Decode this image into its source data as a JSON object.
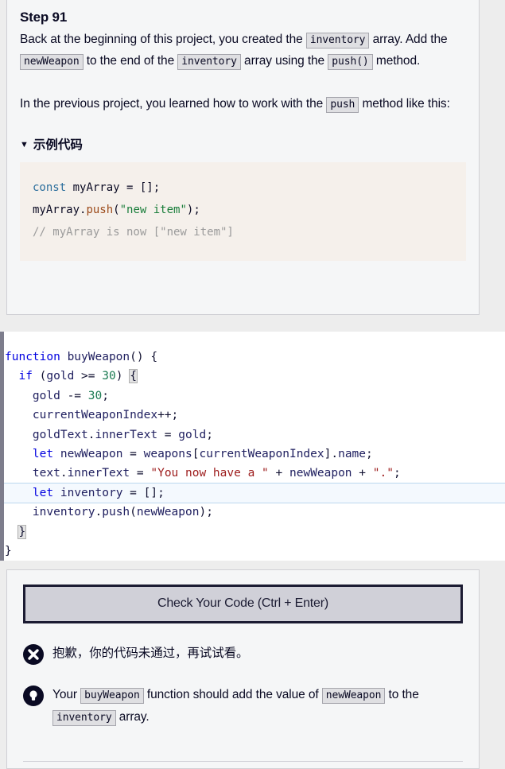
{
  "description": {
    "title": "Step 91",
    "paragraph1": [
      {
        "t": "text",
        "v": "Back at the beginning of this project, you created the "
      },
      {
        "t": "code",
        "v": "inventory"
      },
      {
        "t": "text",
        "v": " array. Add the "
      },
      {
        "t": "code",
        "v": "newWeapon"
      },
      {
        "t": "text",
        "v": " to the end of the "
      },
      {
        "t": "code",
        "v": "inventory"
      },
      {
        "t": "text",
        "v": " array using the "
      },
      {
        "t": "code",
        "v": "push()"
      },
      {
        "t": "text",
        "v": " method."
      }
    ],
    "paragraph2": [
      {
        "t": "text",
        "v": "In the previous project, you learned how to work with the "
      },
      {
        "t": "code",
        "v": "push"
      },
      {
        "t": "text",
        "v": " method like this:"
      }
    ],
    "example": {
      "summary_label": "示例代码",
      "disclosure_glyph": "▼",
      "code_lines": [
        [
          {
            "c": "k-const",
            "v": "const"
          },
          {
            "c": "k-plain",
            "v": " myArray "
          },
          {
            "c": "k-punc",
            "v": "= [];"
          }
        ],
        [
          {
            "c": "k-plain",
            "v": "myArray."
          },
          {
            "c": "k-fn",
            "v": "push"
          },
          {
            "c": "k-punc",
            "v": "("
          },
          {
            "c": "k-str",
            "v": "\"new item\""
          },
          {
            "c": "k-punc",
            "v": ");"
          }
        ],
        [
          {
            "c": "k-cmt",
            "v": "// myArray is now [\"new item\"]"
          }
        ]
      ]
    }
  },
  "editor": {
    "lines": [
      {
        "active": false,
        "tokens": [
          {
            "c": "t-kw",
            "v": "function"
          },
          {
            "c": "t-id",
            "v": " buyWeapon"
          },
          {
            "c": "t-op",
            "v": "() {"
          }
        ]
      },
      {
        "active": false,
        "tokens": [
          {
            "c": "t-op",
            "v": "  "
          },
          {
            "c": "t-kw",
            "v": "if"
          },
          {
            "c": "t-op",
            "v": " ("
          },
          {
            "c": "t-id",
            "v": "gold"
          },
          {
            "c": "t-op",
            "v": " >= "
          },
          {
            "c": "t-num",
            "v": "30"
          },
          {
            "c": "t-op",
            "v": ") "
          },
          {
            "c": "t-op brace-match",
            "v": "{"
          }
        ]
      },
      {
        "active": false,
        "tokens": [
          {
            "c": "t-op",
            "v": "    "
          },
          {
            "c": "t-id",
            "v": "gold"
          },
          {
            "c": "t-op",
            "v": " -= "
          },
          {
            "c": "t-num",
            "v": "30"
          },
          {
            "c": "t-op",
            "v": ";"
          }
        ]
      },
      {
        "active": false,
        "tokens": [
          {
            "c": "t-op",
            "v": "    "
          },
          {
            "c": "t-id",
            "v": "currentWeaponIndex"
          },
          {
            "c": "t-op",
            "v": "++;"
          }
        ]
      },
      {
        "active": false,
        "tokens": [
          {
            "c": "t-op",
            "v": "    "
          },
          {
            "c": "t-id",
            "v": "goldText"
          },
          {
            "c": "t-op",
            "v": "."
          },
          {
            "c": "t-id",
            "v": "innerText"
          },
          {
            "c": "t-op",
            "v": " = "
          },
          {
            "c": "t-id",
            "v": "gold"
          },
          {
            "c": "t-op",
            "v": ";"
          }
        ]
      },
      {
        "active": false,
        "tokens": [
          {
            "c": "t-op",
            "v": "    "
          },
          {
            "c": "t-kw",
            "v": "let"
          },
          {
            "c": "t-id",
            "v": " newWeapon"
          },
          {
            "c": "t-op",
            "v": " = "
          },
          {
            "c": "t-id",
            "v": "weapons"
          },
          {
            "c": "t-op",
            "v": "["
          },
          {
            "c": "t-id",
            "v": "currentWeaponIndex"
          },
          {
            "c": "t-op",
            "v": "]."
          },
          {
            "c": "t-id",
            "v": "name"
          },
          {
            "c": "t-op",
            "v": ";"
          }
        ]
      },
      {
        "active": false,
        "tokens": [
          {
            "c": "t-op",
            "v": "    "
          },
          {
            "c": "t-id",
            "v": "text"
          },
          {
            "c": "t-op",
            "v": "."
          },
          {
            "c": "t-id",
            "v": "innerText"
          },
          {
            "c": "t-op",
            "v": " = "
          },
          {
            "c": "t-str",
            "v": "\"You now have a \""
          },
          {
            "c": "t-op",
            "v": " + "
          },
          {
            "c": "t-id",
            "v": "newWeapon"
          },
          {
            "c": "t-op",
            "v": " + "
          },
          {
            "c": "t-str",
            "v": "\".\""
          },
          {
            "c": "t-op",
            "v": ";"
          }
        ]
      },
      {
        "active": true,
        "tokens": [
          {
            "c": "t-op",
            "v": "    "
          },
          {
            "c": "t-kw",
            "v": "let"
          },
          {
            "c": "t-id",
            "v": " inventory"
          },
          {
            "c": "t-op",
            "v": " = [];"
          }
        ]
      },
      {
        "active": false,
        "tokens": [
          {
            "c": "t-op",
            "v": "    "
          },
          {
            "c": "t-id",
            "v": "inventory"
          },
          {
            "c": "t-op",
            "v": "."
          },
          {
            "c": "t-id",
            "v": "push"
          },
          {
            "c": "t-op",
            "v": "("
          },
          {
            "c": "t-id",
            "v": "newWeapon"
          },
          {
            "c": "t-op",
            "v": ");"
          }
        ]
      },
      {
        "active": false,
        "tokens": [
          {
            "c": "t-op",
            "v": "  "
          },
          {
            "c": "t-op brace-match",
            "v": "}"
          }
        ]
      },
      {
        "active": false,
        "tokens": [
          {
            "c": "t-op",
            "v": "}"
          }
        ]
      }
    ]
  },
  "console": {
    "check_button_label": "Check Your Code (Ctrl + Enter)",
    "failure": {
      "icon": "error-x-icon",
      "text": "抱歉，你的代码未通过，再试试看。"
    },
    "hint": {
      "icon": "lightbulb-icon",
      "parts": [
        {
          "t": "text",
          "v": "Your "
        },
        {
          "t": "code",
          "v": "buyWeapon"
        },
        {
          "t": "text",
          "v": " function should add the value of "
        },
        {
          "t": "code",
          "v": "newWeapon"
        },
        {
          "t": "text",
          "v": " to the "
        },
        {
          "t": "code",
          "v": "inventory"
        },
        {
          "t": "text",
          "v": " array."
        }
      ]
    }
  },
  "colors": {
    "page_bg": "#ededed",
    "panel_bg": "#f5f6f7",
    "panel_border": "#d0d0d5",
    "editor_bg": "#ffffff",
    "editor_gutter": "#7d7d8c",
    "active_line_bg": "#f4f9fe",
    "active_line_border": "#bcd7ef",
    "button_bg": "#d0d0d8",
    "button_border": "#1b1b32",
    "chip_bg": "#dfdfe2",
    "chip_border": "#a6a6ad",
    "example_code_bg": "#f5f0eb",
    "text": "#0a0a23"
  }
}
